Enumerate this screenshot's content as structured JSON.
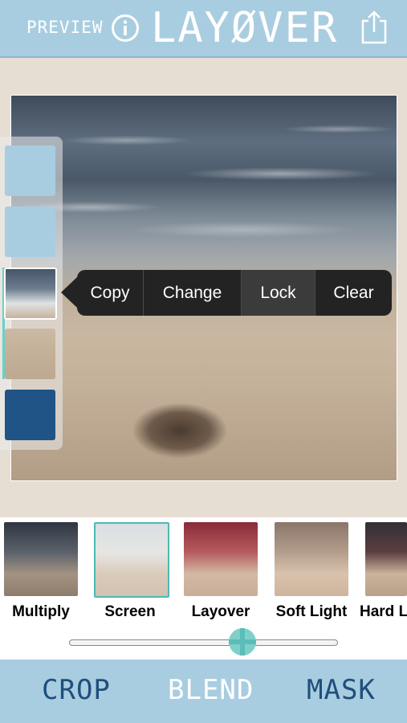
{
  "header": {
    "preview_label": "PREVIEW",
    "logo_text": "LAYØVER",
    "info_icon": "info-circle-icon",
    "share_icon": "share-icon",
    "bg_color": "#a9cde0"
  },
  "layers": {
    "items": [
      {
        "name": "layer-1",
        "color": "#a9cde0"
      },
      {
        "name": "layer-2",
        "color": "#a9cde0"
      },
      {
        "name": "layer-3",
        "kind": "photo-waves",
        "selected": true
      },
      {
        "name": "layer-4",
        "kind": "photo-sand"
      },
      {
        "name": "layer-5",
        "color": "#205487"
      }
    ]
  },
  "popup_menu": {
    "items": [
      "Copy",
      "Change",
      "Lock",
      "Clear"
    ]
  },
  "blend_modes": {
    "items": [
      "Multiply",
      "Screen",
      "Layover",
      "Soft Light",
      "Hard L"
    ],
    "selected": "Screen"
  },
  "slider": {
    "value_fraction": 0.64
  },
  "tabs": {
    "items": [
      "CROP",
      "BLEND",
      "MASK"
    ],
    "active": "BLEND"
  }
}
